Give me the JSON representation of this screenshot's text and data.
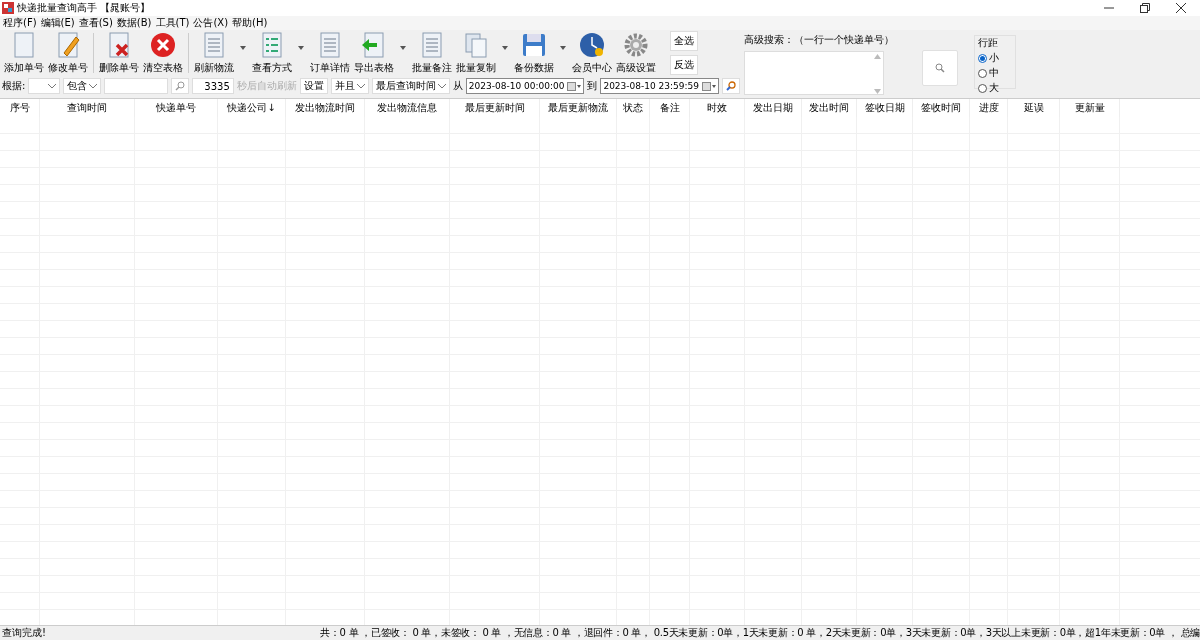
{
  "window": {
    "title": "快递批量查询高手 【晁账号】"
  },
  "menu": [
    "程序(F)",
    "编辑(E)",
    "查看(S)",
    "数据(B)",
    "工具(T)",
    "公告(X)",
    "帮助(H)"
  ],
  "toolbar": [
    {
      "label": "添加单号",
      "dropdown": false,
      "separator_after": false
    },
    {
      "label": "修改单号",
      "dropdown": false,
      "separator_after": true
    },
    {
      "label": "删除单号",
      "dropdown": false,
      "separator_after": false
    },
    {
      "label": "清空表格",
      "dropdown": false,
      "separator_after": true
    },
    {
      "label": "刷新物流",
      "dropdown": true,
      "separator_after": false
    },
    {
      "label": "查看方式",
      "dropdown": true,
      "separator_after": false
    },
    {
      "label": "订单详情",
      "dropdown": false,
      "separator_after": false
    },
    {
      "label": "导出表格",
      "dropdown": true,
      "separator_after": false
    },
    {
      "label": "批量备注",
      "dropdown": false,
      "separator_after": false
    },
    {
      "label": "批量复制",
      "dropdown": true,
      "separator_after": false
    },
    {
      "label": "备份数据",
      "dropdown": true,
      "separator_after": false
    },
    {
      "label": "会员中心",
      "dropdown": false,
      "separator_after": false
    },
    {
      "label": "高级设置",
      "dropdown": false,
      "separator_after": false
    }
  ],
  "select_buttons": [
    "全选",
    "反选"
  ],
  "advanced_search": {
    "label": "高级搜索：（一行一个快递单号）"
  },
  "row_spacing": {
    "title": "行距",
    "options": [
      {
        "label": "小",
        "selected": true
      },
      {
        "label": "中",
        "selected": false
      },
      {
        "label": "大",
        "selected": false
      }
    ]
  },
  "filter": {
    "by_label": "根据:",
    "match": "包含",
    "refresh_seconds": "3335",
    "auto_refresh_label": "秒后自动刷新",
    "settings_button": "设置",
    "logic": "并且",
    "time_field": "最后查询时间",
    "from_label": "从",
    "from": "2023-08-10 00:00:00",
    "to_label": "到",
    "to": "2023-08-10 23:59:59"
  },
  "table": {
    "columns": [
      {
        "label": "序号"
      },
      {
        "label": "查询时间"
      },
      {
        "label": "快递单号"
      },
      {
        "label": "快递公司",
        "sort_mark": "↓"
      },
      {
        "label": "发出物流时间"
      },
      {
        "label": "发出物流信息"
      },
      {
        "label": "最后更新时间"
      },
      {
        "label": "最后更新物流"
      },
      {
        "label": "状态"
      },
      {
        "label": "备注"
      },
      {
        "label": "时效"
      },
      {
        "label": "发出日期"
      },
      {
        "label": "发出时间"
      },
      {
        "label": "签收日期"
      },
      {
        "label": "签收时间"
      },
      {
        "label": "进度"
      },
      {
        "label": "延误"
      },
      {
        "label": "更新量"
      }
    ]
  },
  "status_bar": {
    "message": "查询完成!",
    "summary": "共：0 单 ，已签收： 0 单，未签收： 0 单 ，无信息：0 单 ，退回件：0 单， 0.5天未更新：0单，1天未更新：0 单，2天未更新：0单，3天未更新：0单，3天以上未更新：0单，超1年未更新：0单 ， 总编"
  }
}
